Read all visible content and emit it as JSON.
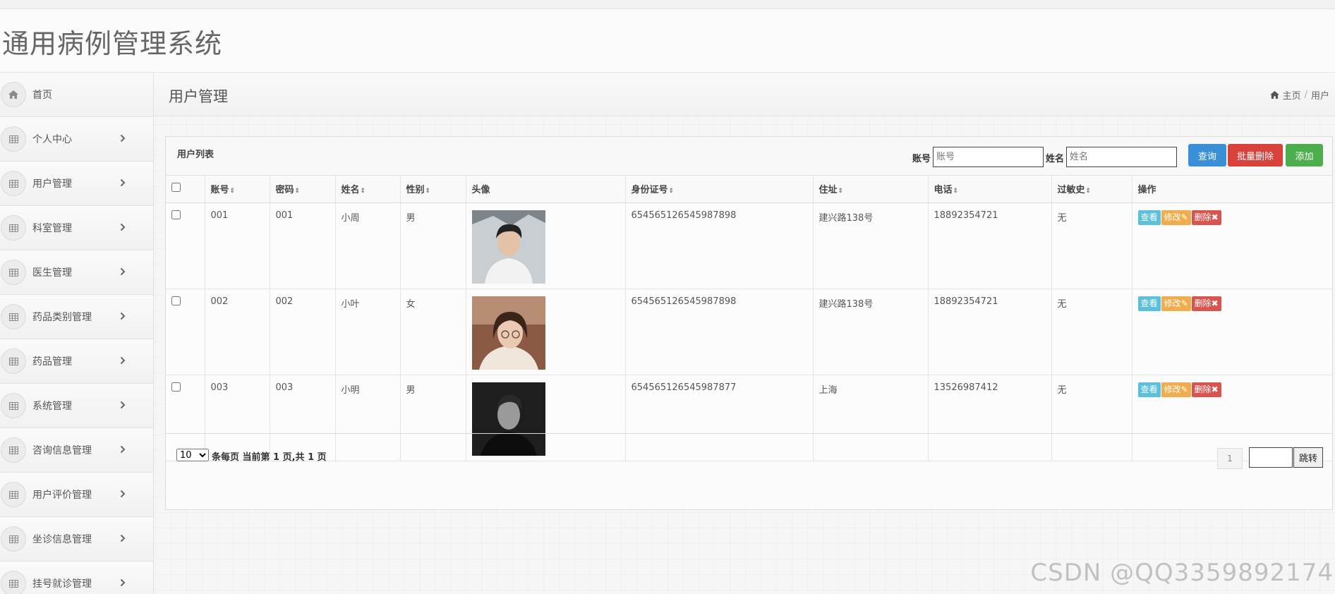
{
  "app": {
    "title": "通用病例管理系统"
  },
  "sidebar": {
    "items": [
      {
        "label": "首页",
        "icon": "home-icon"
      },
      {
        "label": "个人中心",
        "icon": "table-icon"
      },
      {
        "label": "用户管理",
        "icon": "table-icon"
      },
      {
        "label": "科室管理",
        "icon": "table-icon"
      },
      {
        "label": "医生管理",
        "icon": "table-icon"
      },
      {
        "label": "药品类别管理",
        "icon": "table-icon"
      },
      {
        "label": "药品管理",
        "icon": "table-icon"
      },
      {
        "label": "系统管理",
        "icon": "table-icon"
      },
      {
        "label": "咨询信息管理",
        "icon": "table-icon"
      },
      {
        "label": "用户评价管理",
        "icon": "table-icon"
      },
      {
        "label": "坐诊信息管理",
        "icon": "table-icon"
      },
      {
        "label": "挂号就诊管理",
        "icon": "table-icon"
      }
    ]
  },
  "page": {
    "title": "用户管理",
    "breadcrumb": {
      "home": "主页",
      "separator": "/",
      "current": "用户"
    }
  },
  "panel": {
    "title": "用户列表",
    "search": {
      "account_label": "账号",
      "account_placeholder": "账号",
      "name_label": "姓名",
      "name_placeholder": "姓名"
    },
    "buttons": {
      "query": "查询",
      "batch_delete": "批量删除",
      "add": "添加"
    }
  },
  "table": {
    "columns": [
      "账号",
      "密码",
      "姓名",
      "性别",
      "头像",
      "身份证号",
      "住址",
      "电话",
      "过敏史",
      "操作"
    ],
    "sort_icon": "⇕",
    "actions": {
      "view": "查看",
      "edit": "修改",
      "delete": "删除"
    },
    "rows": [
      {
        "account": "001",
        "password": "001",
        "name": "小周",
        "gender": "男",
        "avatar": "avatar-photo-1",
        "id_card": "654565126545987898",
        "address": "建兴路138号",
        "phone": "18892354721",
        "allergy": "无"
      },
      {
        "account": "002",
        "password": "002",
        "name": "小叶",
        "gender": "女",
        "avatar": "avatar-photo-2",
        "id_card": "654565126545987898",
        "address": "建兴路138号",
        "phone": "18892354721",
        "allergy": "无"
      },
      {
        "account": "003",
        "password": "003",
        "name": "小明",
        "gender": "男",
        "avatar": "avatar-photo-3",
        "id_card": "654565126545987877",
        "address": "上海",
        "phone": "13526987412",
        "allergy": "无"
      }
    ]
  },
  "pagination": {
    "page_size": "10",
    "info": "条每页 当前第 1 页,共 1 页",
    "current_page": "1",
    "jump_label": "跳转"
  },
  "watermark": "CSDN @QQ3359892174",
  "colors": {
    "query": "#3a8fd9",
    "batch_delete": "#d9413b",
    "add": "#4cae4c",
    "view": "#5bc0de",
    "edit": "#f0ad4e",
    "delete": "#d9534f"
  }
}
